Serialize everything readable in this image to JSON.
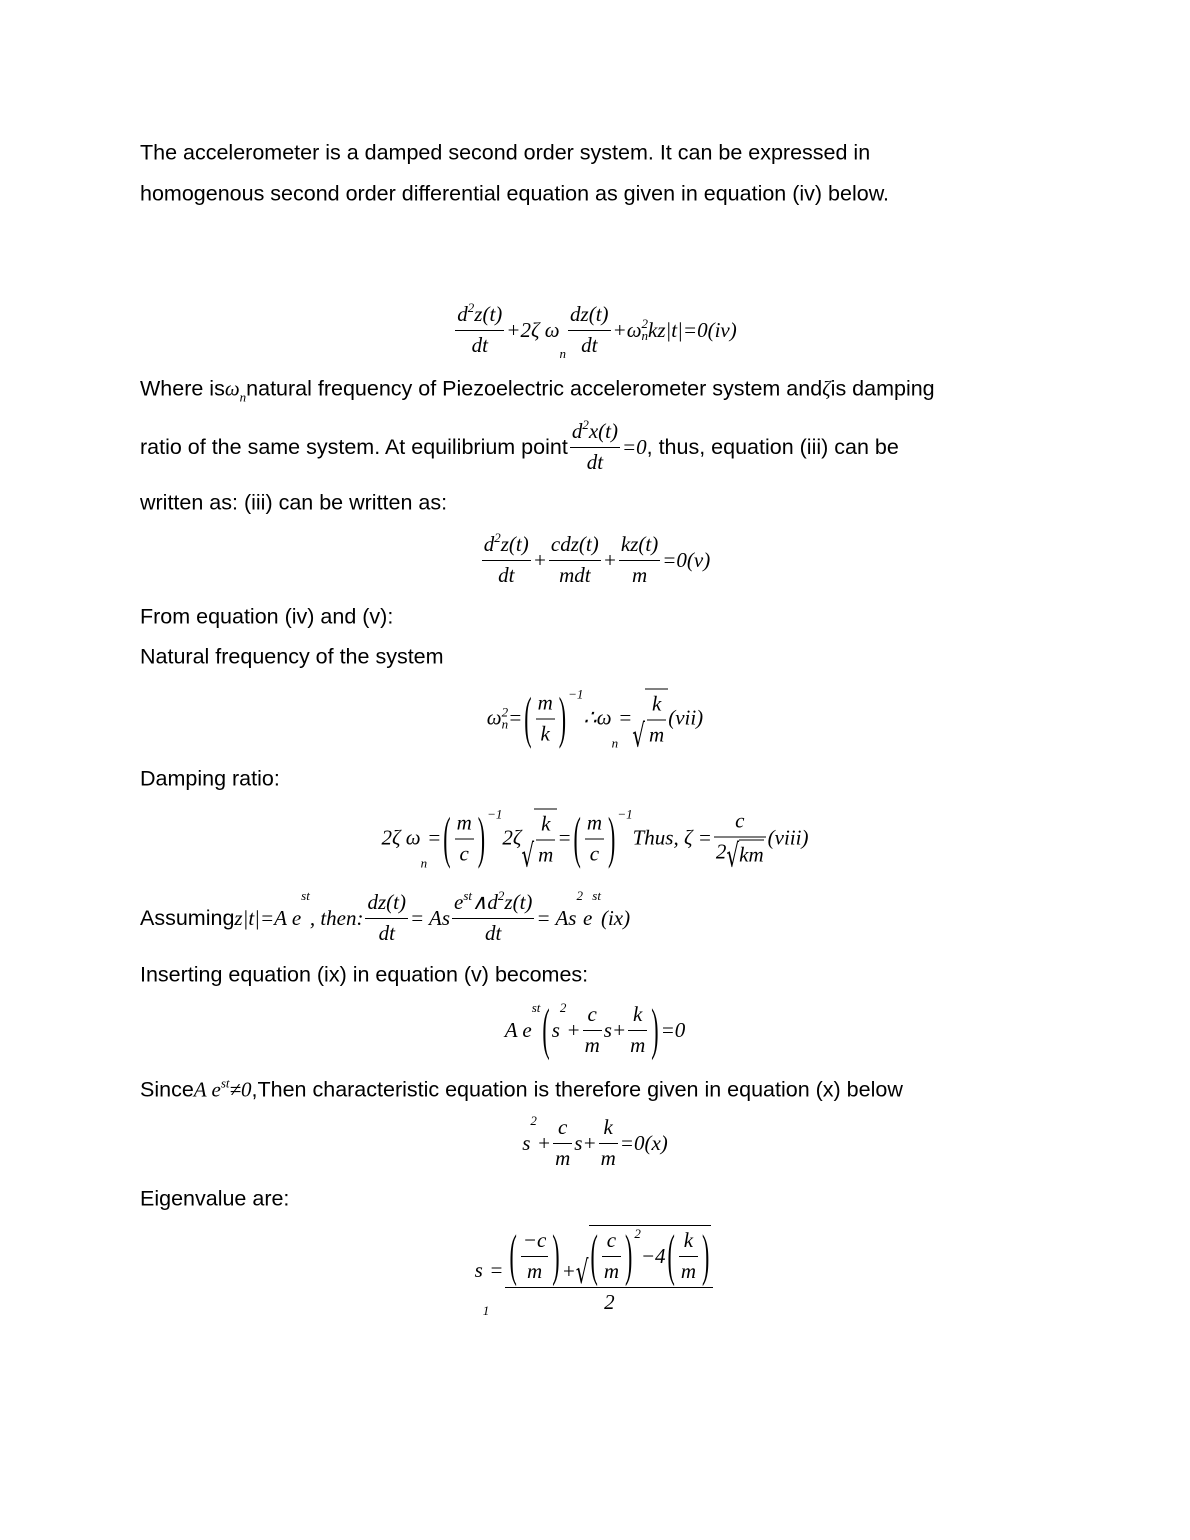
{
  "lines": [
    [
      {
        "t": "The accelerometer is a damped second order system. It can be expressed in"
      }
    ],
    [
      {
        "t": "homogenous second order differential equation as given in equation (iv) below."
      }
    ],
    [
      {
        "f": [
          [
            {
              "m": "d"
            },
            {
              "sup": "2"
            },
            {
              "m": "z(t)"
            }
          ],
          [
            {
              "m": "dt"
            }
          ]
        ]
      },
      {
        "m": "+2ζ ω"
      },
      {
        "sub": "n"
      },
      {
        "f": [
          [
            {
              "m": "dz(t)"
            }
          ],
          [
            {
              "m": "dt"
            }
          ]
        ]
      },
      {
        "m": "+ω"
      },
      {
        "ss": [
          "2",
          "n"
        ]
      },
      {
        "m": "kz|t|=0(iv)"
      }
    ],
    [
      {
        "t": "Where is"
      },
      {
        "m": "ω"
      },
      {
        "sub": "n"
      },
      {
        "t": "natural frequency of Piezoelectric accelerometer system and "
      },
      {
        "m": "ζ"
      },
      {
        "t": "is damping"
      }
    ],
    [
      {
        "t": "ratio of the same system. At equilibrium point "
      },
      {
        "f": [
          [
            {
              "m": "d"
            },
            {
              "sup": "2"
            },
            {
              "m": "x(t)"
            }
          ],
          [
            {
              "m": "dt"
            }
          ]
        ]
      },
      {
        "m": "=0"
      },
      {
        "t": " , thus, equation (iii) can be"
      }
    ],
    [
      {
        "t": "written as: (iii) can be written as:"
      }
    ],
    [
      {
        "f": [
          [
            {
              "m": "d"
            },
            {
              "sup": "2"
            },
            {
              "m": "z(t)"
            }
          ],
          [
            {
              "m": "dt"
            }
          ]
        ]
      },
      {
        "m": "+"
      },
      {
        "f": [
          [
            {
              "m": "cdz(t)"
            }
          ],
          [
            {
              "m": "mdt"
            }
          ]
        ]
      },
      {
        "m": "+"
      },
      {
        "f": [
          [
            {
              "m": "kz(t)"
            }
          ],
          [
            {
              "m": "m"
            }
          ]
        ]
      },
      {
        "m": "=0(v)"
      }
    ],
    [
      {
        "t": "From equation (iv) and (v):"
      }
    ],
    [
      {
        "t": "Natural frequency of the system"
      }
    ],
    [
      {
        "m": "ω"
      },
      {
        "ss": [
          "2",
          "n"
        ]
      },
      {
        "m": "="
      },
      {
        "p": [
          {
            "f": [
              [
                {
                  "m": "m"
                }
              ],
              [
                {
                  "m": "k"
                }
              ]
            ]
          }
        ]
      },
      {
        "sup": "−1"
      },
      {
        "m": "∴ω"
      },
      {
        "sub": "n"
      },
      {
        "m": "="
      },
      {
        "sqrt": [
          {
            "f": [
              [
                {
                  "m": "k"
                }
              ],
              [
                {
                  "m": "m"
                }
              ]
            ]
          }
        ]
      },
      {
        "m": "(vii)"
      }
    ],
    [
      {
        "t": "Damping ratio:"
      }
    ],
    [
      {
        "m": "2ζ ω"
      },
      {
        "sub": "n"
      },
      {
        "m": "="
      },
      {
        "p": [
          {
            "f": [
              [
                {
                  "m": "m"
                }
              ],
              [
                {
                  "m": "c"
                }
              ]
            ]
          }
        ]
      },
      {
        "sup": "−1"
      },
      {
        "m": "2ζ"
      },
      {
        "sqrt": [
          {
            "f": [
              [
                {
                  "m": "k"
                }
              ],
              [
                {
                  "m": "m"
                }
              ]
            ]
          }
        ]
      },
      {
        "m": "="
      },
      {
        "p": [
          {
            "f": [
              [
                {
                  "m": "m"
                }
              ],
              [
                {
                  "m": "c"
                }
              ]
            ]
          }
        ]
      },
      {
        "sup": "−1"
      },
      {
        "m": "Thus, ζ ="
      },
      {
        "f": [
          [
            {
              "m": "c"
            }
          ],
          [
            {
              "m": "2"
            },
            {
              "sqrt": [
                {
                  "m": "km"
                }
              ]
            }
          ]
        ]
      },
      {
        "m": "(viii)"
      }
    ],
    [
      {
        "t": "Assuming"
      },
      {
        "m": "z|t|=A e"
      },
      {
        "sup": "st"
      },
      {
        "m": ", then: "
      },
      {
        "f": [
          [
            {
              "m": "dz(t)"
            }
          ],
          [
            {
              "m": "dt"
            }
          ]
        ]
      },
      {
        "m": "= As "
      },
      {
        "f": [
          [
            {
              "m": "e"
            },
            {
              "sup": "st"
            },
            {
              "m": "∧d"
            },
            {
              "sup": "2"
            },
            {
              "m": " z(t)"
            }
          ],
          [
            {
              "m": "dt"
            }
          ]
        ]
      },
      {
        "m": "= As"
      },
      {
        "sup": "2"
      },
      {
        "m": "e"
      },
      {
        "sup": "st"
      },
      {
        "m": "(ix)"
      }
    ],
    [
      {
        "t": "Inserting equation (ix) in equation (v) becomes:"
      }
    ],
    [
      {
        "m": "A e"
      },
      {
        "sup": "st"
      },
      {
        "p": [
          {
            "m": "s"
          },
          {
            "sup": "2"
          },
          {
            "m": "+"
          },
          {
            "f": [
              [
                {
                  "m": "c"
                }
              ],
              [
                {
                  "m": "m"
                }
              ]
            ]
          },
          {
            "m": "s+"
          },
          {
            "f": [
              [
                {
                  "m": "k"
                }
              ],
              [
                {
                  "m": "m"
                }
              ]
            ]
          }
        ]
      },
      {
        "m": "=0"
      }
    ],
    [
      {
        "t": "Since "
      },
      {
        "m": "A e"
      },
      {
        "sup": "st"
      },
      {
        "m": "≠0"
      },
      {
        "t": ",Then characteristic equation is therefore given in equation (x) below"
      }
    ],
    [
      {
        "m": "s"
      },
      {
        "sup": "2"
      },
      {
        "m": "+"
      },
      {
        "f": [
          [
            {
              "m": "c"
            }
          ],
          [
            {
              "m": "m"
            }
          ]
        ]
      },
      {
        "m": "s+"
      },
      {
        "f": [
          [
            {
              "m": "k"
            }
          ],
          [
            {
              "m": "m"
            }
          ]
        ]
      },
      {
        "m": "=0(x)"
      }
    ],
    [
      {
        "t": "Eigenvalue are:"
      }
    ],
    [
      {
        "m": "s"
      },
      {
        "sub": "1"
      },
      {
        "m": "="
      },
      {
        "f": [
          [
            {
              "p": [
                {
                  "f": [
                    [
                      {
                        "m": "−c"
                      }
                    ],
                    [
                      {
                        "m": "m"
                      }
                    ]
                  ]
                }
              ]
            },
            {
              "m": "+"
            },
            {
              "sqrt": [
                {
                  "p": [
                    {
                      "f": [
                        [
                          {
                            "m": "c"
                          }
                        ],
                        [
                          {
                            "m": "m"
                          }
                        ]
                      ]
                    }
                  ]
                },
                {
                  "sup": "2"
                },
                {
                  "m": "−4"
                },
                {
                  "p": [
                    {
                      "f": [
                        [
                          {
                            "m": "k"
                          }
                        ],
                        [
                          {
                            "m": "m"
                          }
                        ]
                      ]
                    }
                  ]
                }
              ]
            }
          ],
          [
            {
              "m": "2"
            }
          ]
        ]
      }
    ]
  ]
}
